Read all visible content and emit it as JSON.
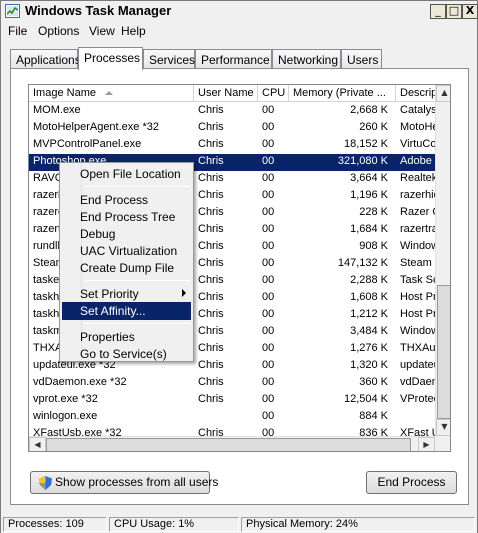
{
  "window": {
    "title": "Windows Task Manager",
    "minimize": "_",
    "maximize": "□",
    "close": "X"
  },
  "menu": [
    "File",
    "Options",
    "View",
    "Help"
  ],
  "tabs": [
    "Applications",
    "Processes",
    "Services",
    "Performance",
    "Networking",
    "Users"
  ],
  "active_tab": "Processes",
  "columns": [
    "Image Name",
    "User Name",
    "CPU",
    "Memory (Private ...",
    "Descriptio"
  ],
  "rows": [
    {
      "name": "MOM.exe",
      "user": "Chris",
      "cpu": "00",
      "mem": "2,668 K",
      "desc": "Catalyst"
    },
    {
      "name": "MotoHelperAgent.exe *32",
      "user": "Chris",
      "cpu": "00",
      "mem": "260 K",
      "desc": "MotoHelp"
    },
    {
      "name": "MVPControlPanel.exe",
      "user": "Chris",
      "cpu": "00",
      "mem": "18,152 K",
      "desc": "VirtuCont"
    },
    {
      "name": "Photoshop.exe",
      "user": "Chris",
      "cpu": "00",
      "mem": "321,080 K",
      "desc": "Adobe Ph"
    },
    {
      "name": "RAVCpl64.exe",
      "user": "Chris",
      "cpu": "00",
      "mem": "3,664 K",
      "desc": "Realtek H"
    },
    {
      "name": "razerhid.exe",
      "user": "Chris",
      "cpu": "00",
      "mem": "1,196 K",
      "desc": "razerhid"
    },
    {
      "name": "razerofa.exe",
      "user": "Chris",
      "cpu": "00",
      "mem": "228 K",
      "desc": "Razer OF"
    },
    {
      "name": "razertra.exe",
      "user": "Chris",
      "cpu": "00",
      "mem": "1,684 K",
      "desc": "razertra"
    },
    {
      "name": "rundll32.exe",
      "user": "Chris",
      "cpu": "00",
      "mem": "908 K",
      "desc": "Windows"
    },
    {
      "name": "Steam.exe",
      "user": "Chris",
      "cpu": "00",
      "mem": "147,132 K",
      "desc": "Steam"
    },
    {
      "name": "taskeng.exe",
      "user": "Chris",
      "cpu": "00",
      "mem": "2,288 K",
      "desc": "Task Sche"
    },
    {
      "name": "taskhost.exe",
      "user": "Chris",
      "cpu": "00",
      "mem": "1,608 K",
      "desc": "Host Proc"
    },
    {
      "name": "taskhost.exe",
      "user": "Chris",
      "cpu": "00",
      "mem": "1,212 K",
      "desc": "Host Proc"
    },
    {
      "name": "taskmgr.exe",
      "user": "Chris",
      "cpu": "00",
      "mem": "3,484 K",
      "desc": "Windows"
    },
    {
      "name": "THXAudio.exe",
      "user": "Chris",
      "cpu": "00",
      "mem": "1,276 K",
      "desc": "THXAudio"
    },
    {
      "name": "updateui.exe *32",
      "user": "Chris",
      "cpu": "00",
      "mem": "1,320 K",
      "desc": "updateui."
    },
    {
      "name": "vdDaemon.exe *32",
      "user": "Chris",
      "cpu": "00",
      "mem": "360 K",
      "desc": "vdDaemon"
    },
    {
      "name": "vprot.exe *32",
      "user": "Chris",
      "cpu": "00",
      "mem": "12,504 K",
      "desc": "VProtect"
    },
    {
      "name": "winlogon.exe",
      "user": "",
      "cpu": "00",
      "mem": "884 K",
      "desc": ""
    },
    {
      "name": "XFastUsb.exe *32",
      "user": "Chris",
      "cpu": "00",
      "mem": "836 K",
      "desc": "XFast US"
    }
  ],
  "selected_row": "Photoshop.exe",
  "context_menu": {
    "open_file_location": "Open File Location",
    "end_process": "End Process",
    "end_process_tree": "End Process Tree",
    "debug": "Debug",
    "uac_virtualization": "UAC Virtualization",
    "create_dump_file": "Create Dump File",
    "set_priority": "Set Priority",
    "set_affinity": "Set Affinity...",
    "properties": "Properties",
    "go_to_services": "Go to Service(s)"
  },
  "buttons": {
    "show_all": "Show processes from all users",
    "end_process": "End Process"
  },
  "status": {
    "processes": "Processes: 109",
    "cpu": "CPU Usage: 1%",
    "memory": "Physical Memory: 24%"
  },
  "colors": {
    "selection": "#0a246a",
    "window_bg": "#f0f0f0"
  }
}
